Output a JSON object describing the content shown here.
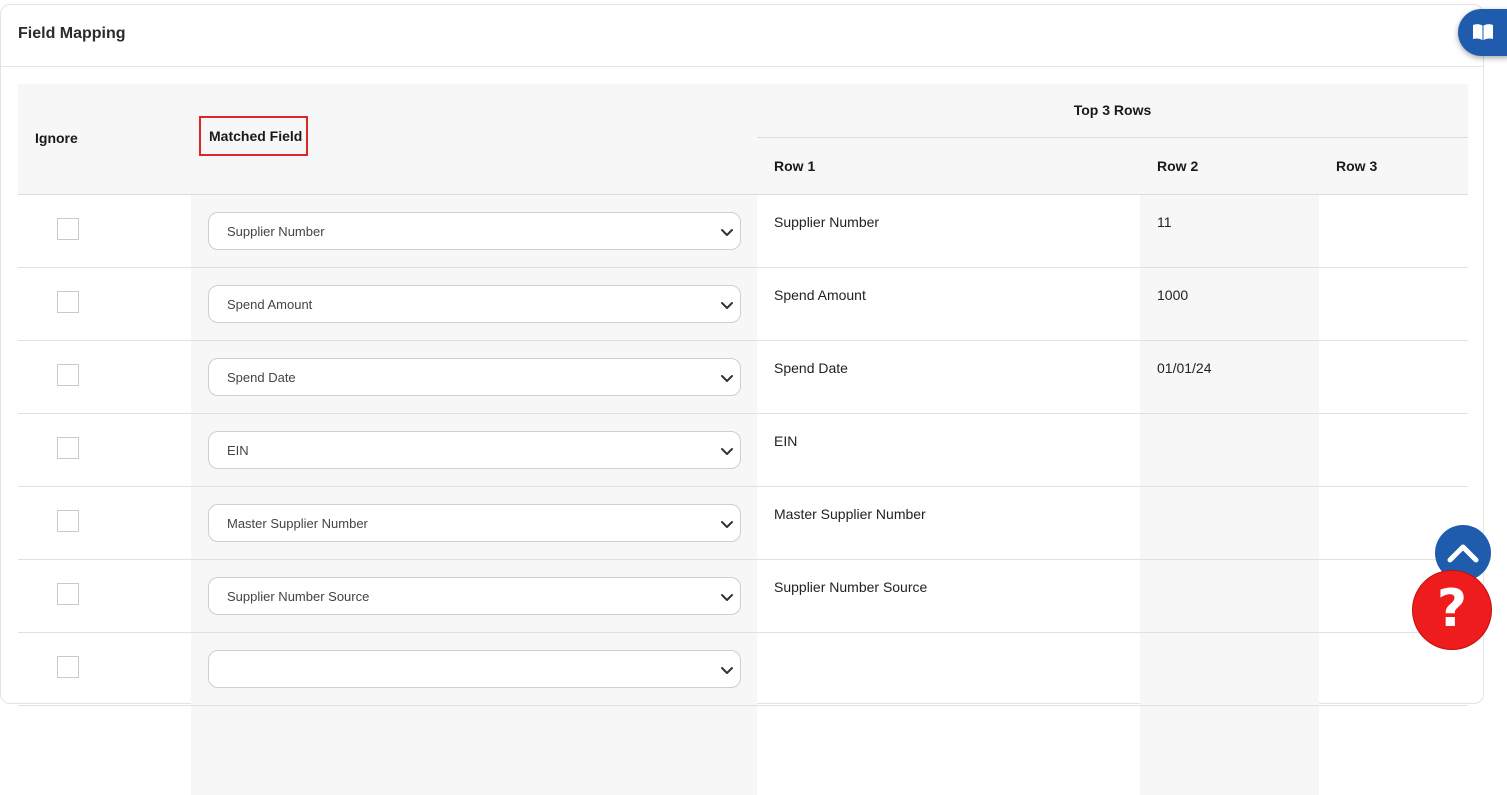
{
  "panel": {
    "title": "Field Mapping"
  },
  "table": {
    "headers": {
      "ignore": "Ignore",
      "matched_field": "Matched Field",
      "top_rows": "Top 3 Rows",
      "row1": "Row 1",
      "row2": "Row 2",
      "row3": "Row 3"
    },
    "rows": [
      {
        "ignored": false,
        "matched": "Supplier Number",
        "row1": "Supplier Number",
        "row2": "11",
        "row3": ""
      },
      {
        "ignored": false,
        "matched": "Spend Amount",
        "row1": "Spend Amount",
        "row2": "1000",
        "row3": ""
      },
      {
        "ignored": false,
        "matched": "Spend Date",
        "row1": "Spend Date",
        "row2": "01/01/24",
        "row3": ""
      },
      {
        "ignored": false,
        "matched": "EIN",
        "row1": "EIN",
        "row2": "",
        "row3": ""
      },
      {
        "ignored": false,
        "matched": "Master Supplier Number",
        "row1": "Master Supplier Number",
        "row2": "",
        "row3": ""
      },
      {
        "ignored": false,
        "matched": "Supplier Number Source",
        "row1": "Supplier Number Source",
        "row2": "",
        "row3": ""
      },
      {
        "ignored": false,
        "matched": "",
        "row1": "",
        "row2": "",
        "row3": ""
      }
    ]
  },
  "floating": {
    "docs_icon": "book-icon",
    "scroll_icon": "chevron-up-icon",
    "help_label": "?"
  },
  "colors": {
    "accent_blue": "#1f5cad",
    "help_red": "#ee1c1c",
    "highlight_border": "#d62a2a"
  }
}
